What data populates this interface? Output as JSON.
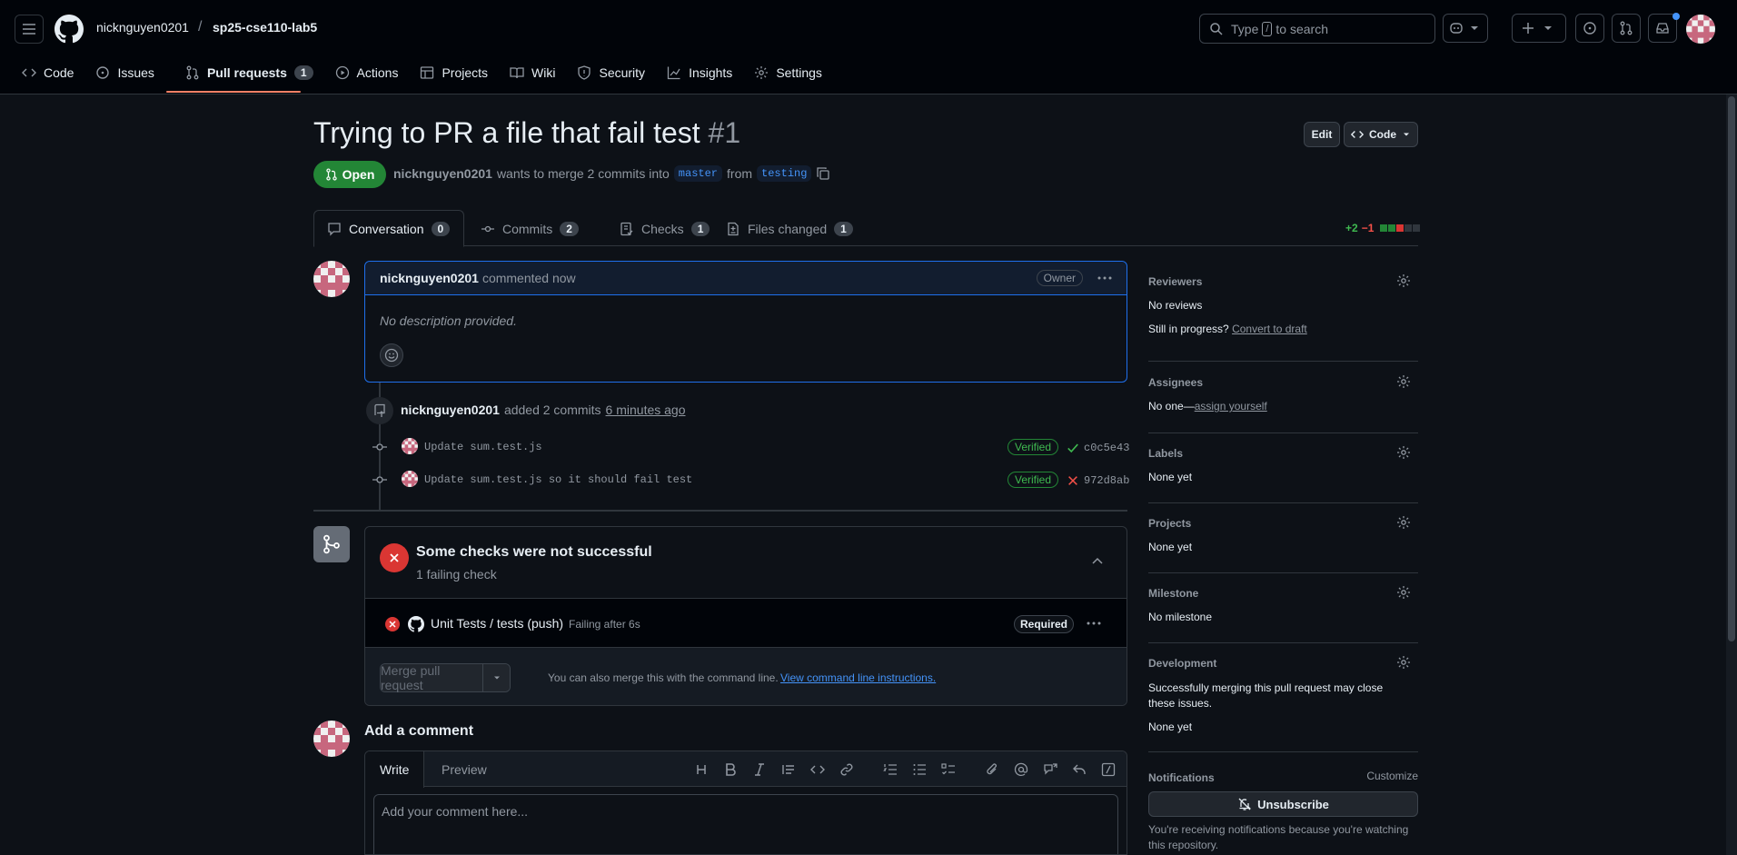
{
  "nav": {
    "owner": "nicknguyen0201",
    "separator": "/",
    "repo": "sp25-cse110-lab5",
    "search_placeholder_pre": "Type",
    "search_key": "/",
    "search_placeholder_post": "to search"
  },
  "repo_tabs": [
    {
      "label": "Code",
      "icon": "code-icon"
    },
    {
      "label": "Issues",
      "icon": "issue-icon"
    },
    {
      "label": "Pull requests",
      "icon": "pull-request-icon",
      "count": "1",
      "active": true
    },
    {
      "label": "Actions",
      "icon": "play-icon"
    },
    {
      "label": "Projects",
      "icon": "table-icon"
    },
    {
      "label": "Wiki",
      "icon": "book-icon"
    },
    {
      "label": "Security",
      "icon": "shield-icon"
    },
    {
      "label": "Insights",
      "icon": "graph-icon"
    },
    {
      "label": "Settings",
      "icon": "gear-icon"
    }
  ],
  "pr": {
    "title": "Trying to PR a file that fail test",
    "number": "#1",
    "edit_label": "Edit",
    "code_label": "Code",
    "state": "Open",
    "author": "nicknguyen0201",
    "meta_text": "wants to merge 2 commits into",
    "base_branch": "master",
    "from_text": "from",
    "head_branch": "testing"
  },
  "pr_tabs": [
    {
      "label": "Conversation",
      "count": "0",
      "icon": "comment-icon",
      "active": true
    },
    {
      "label": "Commits",
      "count": "2",
      "icon": "commit-icon"
    },
    {
      "label": "Checks",
      "count": "1",
      "icon": "checklist-icon"
    },
    {
      "label": "Files changed",
      "count": "1",
      "icon": "file-diff-icon"
    }
  ],
  "diffstat": {
    "additions": "+2",
    "deletions": "−1"
  },
  "comment": {
    "author": "nicknguyen0201",
    "action": "commented now",
    "badge": "Owner",
    "body": "No description provided."
  },
  "commits_event": {
    "author": "nicknguyen0201",
    "text": "added 2 commits",
    "time": "6 minutes ago",
    "commits": [
      {
        "message": "Update sum.test.js",
        "verified": "Verified",
        "status": "success",
        "sha": "c0c5e43"
      },
      {
        "message": "Update sum.test.js so it should fail test",
        "verified": "Verified",
        "status": "failure",
        "sha": "972d8ab"
      }
    ]
  },
  "merge_box": {
    "title": "Some checks were not successful",
    "subtitle": "1 failing check",
    "check_name": "Unit Tests / tests (push)",
    "check_status": "Failing after 6s",
    "required": "Required",
    "merge_button": "Merge pull request",
    "cli_text": "You can also merge this with the command line.",
    "cli_link": "View command line instructions."
  },
  "sidebar": {
    "reviewers_title": "Reviewers",
    "reviewers_value": "No reviews",
    "in_progress": "Still in progress?",
    "convert_draft": "Convert to draft",
    "assignees_title": "Assignees",
    "assignees_value": "No one—",
    "assign_yourself": "assign yourself",
    "labels_title": "Labels",
    "labels_value": "None yet",
    "projects_title": "Projects",
    "projects_value": "None yet",
    "milestone_title": "Milestone",
    "milestone_value": "No milestone",
    "development_title": "Development",
    "development_text": "Successfully merging this pull request may close these issues.",
    "development_value": "None yet",
    "notifications_title": "Notifications",
    "customize": "Customize",
    "unsubscribe": "Unsubscribe",
    "notif_reason": "You're receiving notifications because you're watching this repository."
  },
  "add_comment": {
    "title": "Add a comment",
    "write_tab": "Write",
    "preview_tab": "Preview",
    "placeholder": "Add your comment here..."
  },
  "colors": {
    "accent": "#1f6feb",
    "success": "#238636",
    "danger": "#da3633",
    "tab_underline": "#f78166"
  }
}
